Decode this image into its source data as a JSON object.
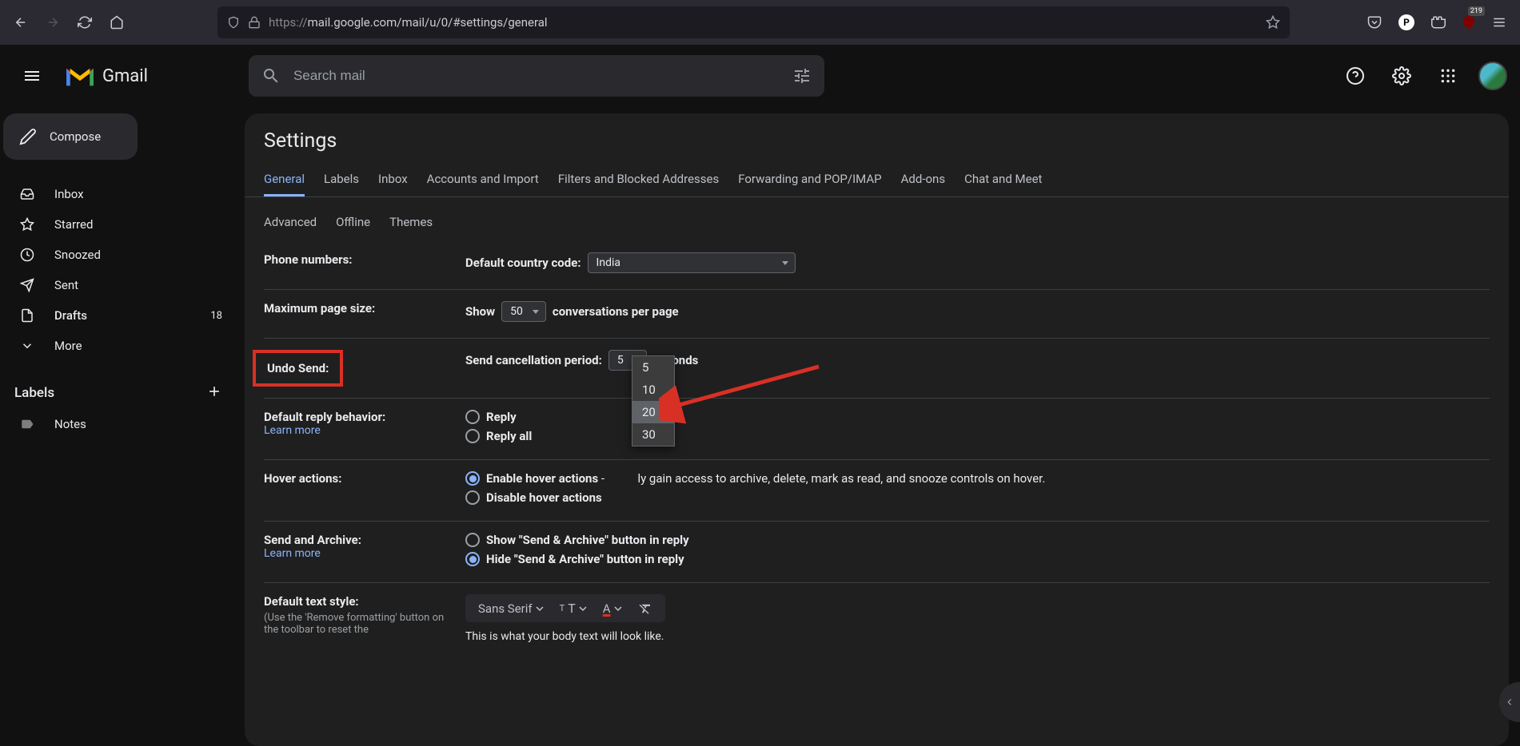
{
  "browser": {
    "url_proto": "https://",
    "url_rest": "mail.google.com/mail/u/0/#settings/general",
    "ext_count": "219"
  },
  "header": {
    "app_name": "Gmail",
    "search_placeholder": "Search mail"
  },
  "sidebar": {
    "compose": "Compose",
    "items": [
      {
        "label": "Inbox",
        "count": ""
      },
      {
        "label": "Starred",
        "count": ""
      },
      {
        "label": "Snoozed",
        "count": ""
      },
      {
        "label": "Sent",
        "count": ""
      },
      {
        "label": "Drafts",
        "count": "18"
      },
      {
        "label": "More",
        "count": ""
      }
    ],
    "labels_title": "Labels",
    "label_items": [
      {
        "label": "Notes"
      }
    ]
  },
  "settings": {
    "title": "Settings",
    "tabs1": [
      "General",
      "Labels",
      "Inbox",
      "Accounts and Import",
      "Filters and Blocked Addresses",
      "Forwarding and POP/IMAP",
      "Add-ons",
      "Chat and Meet"
    ],
    "tabs2": [
      "Advanced",
      "Offline",
      "Themes"
    ],
    "rows": {
      "phone": {
        "label": "Phone numbers:",
        "value_label": "Default country code:",
        "select_value": "India"
      },
      "pagesize": {
        "label": "Maximum page size:",
        "show": "Show",
        "select_value": "50",
        "suffix": "conversations per page"
      },
      "undo": {
        "label": "Undo Send:",
        "value_label": "Send cancellation period:",
        "select_value": "5",
        "suffix": "seconds",
        "options": [
          "5",
          "10",
          "20",
          "30"
        ]
      },
      "reply": {
        "label": "Default reply behavior:",
        "learn": "Learn more",
        "opt1": "Reply",
        "opt2": "Reply all"
      },
      "hover": {
        "label": "Hover actions:",
        "opt1": "Enable hover actions",
        "opt1_desc_pre": " - ",
        "opt1_desc_post": "ly gain access to archive, delete, mark as read, and snooze controls on hover.",
        "opt2": "Disable hover actions"
      },
      "archive": {
        "label": "Send and Archive:",
        "learn": "Learn more",
        "opt1": "Show \"Send & Archive\" button in reply",
        "opt2": "Hide \"Send & Archive\" button in reply"
      },
      "textstyle": {
        "label": "Default text style:",
        "sub": "(Use the 'Remove formatting' button on the toolbar to reset the",
        "font": "Sans Serif",
        "preview": "This is what your body text will look like."
      }
    }
  }
}
